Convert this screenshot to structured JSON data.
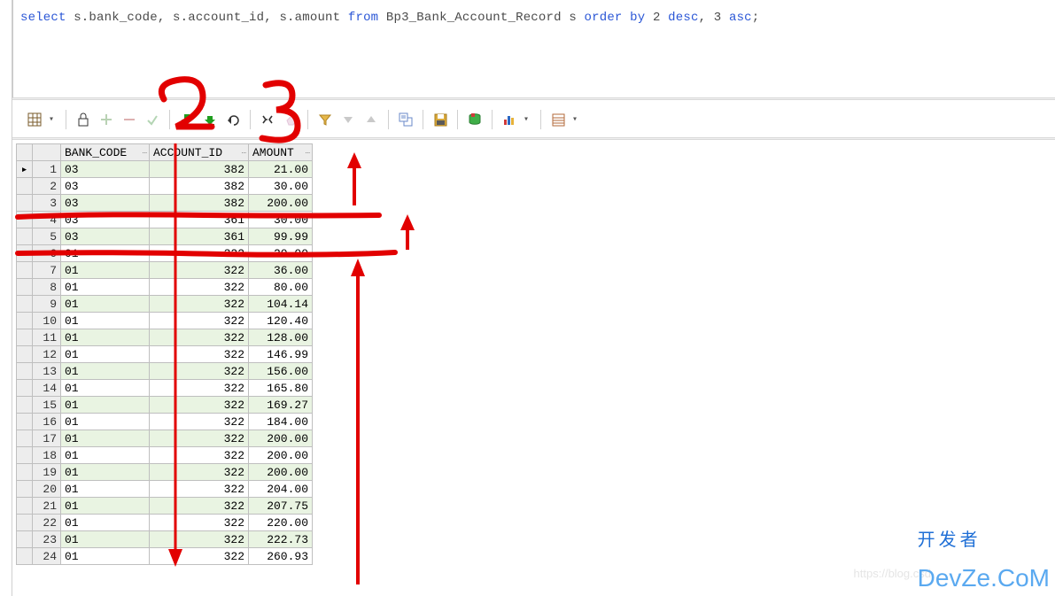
{
  "sql": {
    "kw_select": "select",
    "cols": " s.bank_code, s.account_id, s.amount ",
    "kw_from": "from",
    "table": " Bp3_Bank_Account_Record s  ",
    "kw_order": "order by",
    "tail_1": " 2 ",
    "kw_desc": "desc",
    "tail_2": ", 3 ",
    "kw_asc": "asc",
    "tail_3": ";"
  },
  "toolbar": {
    "icons": {
      "grid": "grid-icon",
      "lock": "lock-icon",
      "plus": "plus-icon",
      "minus": "minus-icon",
      "check": "check-icon",
      "commit": "commit-icon",
      "commit_cursor": "commit-cursor-icon",
      "undo": "undo-icon",
      "find": "find-icon",
      "eraser": "eraser-icon",
      "filter": "filter-icon",
      "down": "chevron-down-icon",
      "up": "chevron-up-icon",
      "props": "properties-icon",
      "save": "save-icon",
      "disk": "disk-db-icon",
      "chart": "chart-icon",
      "list": "list-icon"
    }
  },
  "columns": {
    "bank": "BANK_CODE",
    "acct": "ACCOUNT_ID",
    "amt": "AMOUNT"
  },
  "rows": [
    {
      "n": "1",
      "bank": "03",
      "acct": "382",
      "amt": "21.00"
    },
    {
      "n": "2",
      "bank": "03",
      "acct": "382",
      "amt": "30.00"
    },
    {
      "n": "3",
      "bank": "03",
      "acct": "382",
      "amt": "200.00"
    },
    {
      "n": "4",
      "bank": "03",
      "acct": "361",
      "amt": "30.00"
    },
    {
      "n": "5",
      "bank": "03",
      "acct": "361",
      "amt": "99.99"
    },
    {
      "n": "6",
      "bank": "01",
      "acct": "322",
      "amt": "20.00"
    },
    {
      "n": "7",
      "bank": "01",
      "acct": "322",
      "amt": "36.00"
    },
    {
      "n": "8",
      "bank": "01",
      "acct": "322",
      "amt": "80.00"
    },
    {
      "n": "9",
      "bank": "01",
      "acct": "322",
      "amt": "104.14"
    },
    {
      "n": "10",
      "bank": "01",
      "acct": "322",
      "amt": "120.40"
    },
    {
      "n": "11",
      "bank": "01",
      "acct": "322",
      "amt": "128.00"
    },
    {
      "n": "12",
      "bank": "01",
      "acct": "322",
      "amt": "146.99"
    },
    {
      "n": "13",
      "bank": "01",
      "acct": "322",
      "amt": "156.00"
    },
    {
      "n": "14",
      "bank": "01",
      "acct": "322",
      "amt": "165.80"
    },
    {
      "n": "15",
      "bank": "01",
      "acct": "322",
      "amt": "169.27"
    },
    {
      "n": "16",
      "bank": "01",
      "acct": "322",
      "amt": "184.00"
    },
    {
      "n": "17",
      "bank": "01",
      "acct": "322",
      "amt": "200.00"
    },
    {
      "n": "18",
      "bank": "01",
      "acct": "322",
      "amt": "200.00"
    },
    {
      "n": "19",
      "bank": "01",
      "acct": "322",
      "amt": "200.00"
    },
    {
      "n": "20",
      "bank": "01",
      "acct": "322",
      "amt": "204.00"
    },
    {
      "n": "21",
      "bank": "01",
      "acct": "322",
      "amt": "207.75"
    },
    {
      "n": "22",
      "bank": "01",
      "acct": "322",
      "amt": "220.00"
    },
    {
      "n": "23",
      "bank": "01",
      "acct": "322",
      "amt": "222.73"
    },
    {
      "n": "24",
      "bank": "01",
      "acct": "322",
      "amt": "260.93"
    }
  ],
  "watermark": {
    "text": "DevZe.CoM",
    "cn": "开发者",
    "faint": "https://blog.csd"
  },
  "colors": {
    "annotation": "#e20000"
  }
}
